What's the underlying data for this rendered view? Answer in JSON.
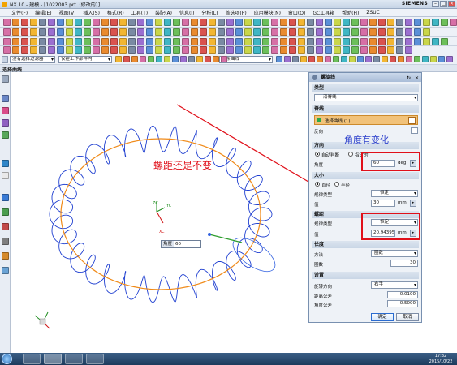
{
  "window": {
    "title": "NX 10 - 建模 - [1022003.prt（修改的）]",
    "brand": "SIEMENS",
    "min_label": "–",
    "max_label": "□",
    "close_label": "×"
  },
  "menu": [
    "文件(F)",
    "编辑(E)",
    "视图(V)",
    "插入(S)",
    "格式(R)",
    "工具(T)",
    "装配(A)",
    "信息(I)",
    "分析(L)",
    "首选项(P)",
    "应用模块(N)",
    "窗口(O)",
    "GC工具箱",
    "帮助(H)",
    "ZSUC"
  ],
  "selection_bar": {
    "filter": "没有选择过滤器",
    "scope": "仅在工作部件内",
    "curve_rule": "单条曲线"
  },
  "nav": {
    "title": "选择曲线"
  },
  "annotations": {
    "pitch_note": "螺距还是不变",
    "angle_note": "角度有变化"
  },
  "viewport": {
    "angle_label": "角度",
    "angle_value": "60",
    "axis_xc": "XC",
    "axis_yc": "YC",
    "axis_zc": "ZC"
  },
  "dialog": {
    "title": "螺旋线",
    "type_section": "类型",
    "type_value": "沿脊线",
    "spine_section": "脊线",
    "select_curve": "选择曲线 (1)",
    "reverse": "反向",
    "direction_section": "方向",
    "auto_judge": "自动判断",
    "specified": "指定的",
    "angle_label": "角度",
    "angle_value": "60",
    "angle_unit": "deg",
    "size_section": "大小",
    "diameter": "直径",
    "radius": "半径",
    "law_type_label": "规律类型",
    "size_law": "恒定",
    "value_label": "值",
    "size_value": "30",
    "mm": "mm",
    "pitch_section": "螺距",
    "pitch_law": "恒定",
    "pitch_value": "20.943951",
    "length_section": "长度",
    "method_label": "方法",
    "method_value": "圈数",
    "turns_label": "圈数",
    "turns_value": "30",
    "settings_section": "设置",
    "rotation_label": "旋转方向",
    "rotation_value": "右手",
    "dist_tol_label": "距离公差",
    "dist_tol_value": "0.0100",
    "angle_tol_label": "角度公差",
    "angle_tol_value": "0.5000",
    "ok": "确定",
    "cancel": "取消"
  },
  "taskbar": {
    "time": "17:32",
    "date": "2015/10/22"
  },
  "colors": {
    "annotation_red": "#e0101a",
    "helix_blue": "#1f3fd0",
    "spine_orange": "#f08a18"
  }
}
